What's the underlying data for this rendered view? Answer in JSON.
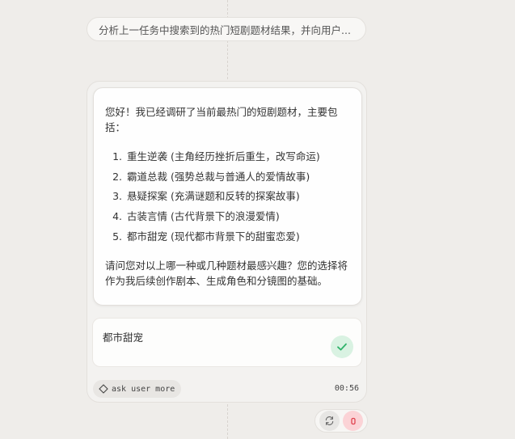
{
  "task": {
    "text": "分析上一任务中搜索到的热门短剧题材结果，并向用户..."
  },
  "message": {
    "intro": "您好！我已经调研了当前最热门的短剧题材，主要包括：",
    "items": [
      "重生逆袭 (主角经历挫折后重生，改写命运)",
      "霸道总裁 (强势总裁与普通人的爱情故事)",
      "悬疑探案 (充满谜题和反转的探案故事)",
      "古装言情 (古代背景下的浪漫爱情)",
      "都市甜宠 (现代都市背景下的甜蜜恋爱)"
    ],
    "outro": "请问您对以上哪一种或几种题材最感兴趣？您的选择将作为我后续创作剧本、生成角色和分镜图的基础。"
  },
  "answer": {
    "text": "都市甜宠"
  },
  "tag": {
    "label": "ask user more",
    "icon": "diamond-icon"
  },
  "timestamp": "00:56",
  "colors": {
    "check_bg": "#d9f2e2",
    "check_icon": "#2fb36a",
    "stop_bg": "#fbd3d6",
    "stop_icon": "#e0434f"
  }
}
